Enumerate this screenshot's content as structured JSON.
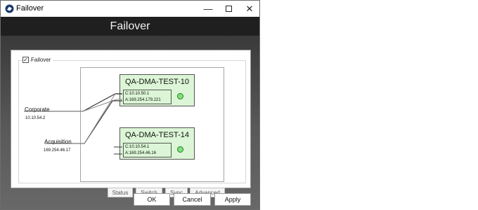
{
  "window": {
    "title": "Failover",
    "controls": {
      "minimize": "—",
      "close": "✕"
    }
  },
  "header": {
    "title": "Failover"
  },
  "failover_checkbox": {
    "label": "Failover",
    "checked": true,
    "mark": "✓"
  },
  "networks": [
    {
      "name": "Corporate",
      "ip": "10.10.54.2"
    },
    {
      "name": "Acquisition",
      "ip": "169.254.46.17"
    }
  ],
  "servers": [
    {
      "name": "QA-DMA-TEST-10",
      "ip_c": "C:10.10.50.1",
      "ip_a": "A:169.254.179.221",
      "status": "online"
    },
    {
      "name": "QA-DMA-TEST-14",
      "ip_c": "C:10.10.54.1",
      "ip_a": "A:169.254.46.16",
      "status": "online"
    }
  ],
  "actions": [
    "Status",
    "Switch",
    "Sync",
    "Advanced"
  ],
  "dialog_buttons": {
    "ok": "OK",
    "cancel": "Cancel",
    "apply": "Apply"
  },
  "colors": {
    "server_fill": "#dcf5d6",
    "status_led": "#7fe27a",
    "header_bg": "#1f1f1f"
  },
  "icons": {
    "app": "failover-app-icon",
    "minimize": "minimize-icon",
    "maximize": "maximize-icon",
    "close": "close-icon",
    "status": "status-led-icon"
  }
}
